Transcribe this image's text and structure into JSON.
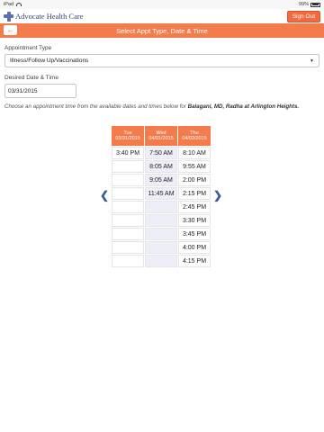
{
  "status": {
    "device": "iPad",
    "battery": "99%"
  },
  "header": {
    "brand": "Advocate Health Care",
    "signout_label": "Sign Out"
  },
  "titlebar": {
    "title": "Select Appt Type, Date & Time",
    "back_icon": "arrow-left-icon"
  },
  "form": {
    "appt_type_label": "Appointment Type",
    "appt_type_value": "Illness/Follow Up/Vaccinations",
    "date_label": "Desired Date & Time",
    "date_value": "03/31/2015",
    "instructions_prefix": "Choose an appointment time from the available dates and times below for ",
    "instructions_provider": "Balagani, MD, Radha at Arlington Heights."
  },
  "schedule": {
    "columns": [
      {
        "day": "Tue",
        "date": "03/31/2015",
        "slots": [
          "3:40 PM",
          "",
          "",
          "",
          "",
          "",
          "",
          "",
          ""
        ]
      },
      {
        "day": "Wed",
        "date": "04/01/2015",
        "slots": [
          "7:50 AM",
          "8:05 AM",
          "9:05 AM",
          "11:45 AM",
          "",
          "",
          "",
          "",
          ""
        ]
      },
      {
        "day": "Thu",
        "date": "04/02/2015",
        "slots": [
          "8:10 AM",
          "9:55 AM",
          "2:00 PM",
          "2:15 PM",
          "2:45 PM",
          "3:30 PM",
          "3:45 PM",
          "4:00 PM",
          "4:15 PM"
        ]
      }
    ],
    "prev_icon": "chevron-left-icon",
    "next_icon": "chevron-right-icon"
  },
  "colors": {
    "accent": "#f47c4c",
    "brand": "#2d3f8a",
    "nav": "#3d5a9e"
  }
}
